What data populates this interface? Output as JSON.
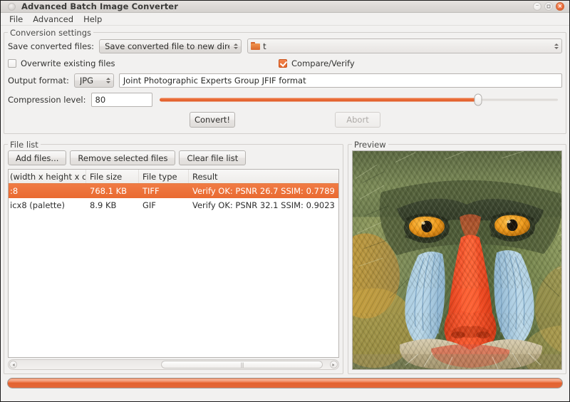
{
  "window": {
    "title": "Advanced Batch Image Converter",
    "app_icon": "app-circle-icon",
    "controls": {
      "minimize": "–",
      "maximize": "□",
      "close": "×"
    }
  },
  "menubar": {
    "items": [
      {
        "label": "File"
      },
      {
        "label": "Advanced"
      },
      {
        "label": "Help"
      }
    ]
  },
  "conversion_settings": {
    "group_title": "Conversion settings",
    "save_label": "Save converted files:",
    "save_mode": "Save converted file to new directory",
    "directory_value": "t",
    "directory_icon": "folder-icon",
    "overwrite_label": "Overwrite existing files",
    "overwrite_checked": false,
    "compare_label": "Compare/Verify",
    "compare_checked": true,
    "output_format_label": "Output format:",
    "output_format": "JPG",
    "output_format_description": "Joint Photographic Experts Group JFIF format",
    "compression_label": "Compression level:",
    "compression_value": "80",
    "compression_percent": 80,
    "convert_label": "Convert!",
    "abort_label": "Abort",
    "abort_disabled": true
  },
  "file_list": {
    "group_title": "File list",
    "buttons": [
      {
        "label": "Add files...",
        "name": "add-files-button"
      },
      {
        "label": "Remove selected files",
        "name": "remove-selected-files-button"
      },
      {
        "label": "Clear file list",
        "name": "clear-file-list-button"
      }
    ],
    "columns": [
      "(width x height x col",
      "File size",
      "File type",
      "Result"
    ],
    "rows": [
      {
        "dimensions": ":8",
        "file_size": "768.1 KB",
        "file_type": "TIFF",
        "result": "Verify OK: PSNR 26.7 SSIM: 0.7789",
        "selected": true
      },
      {
        "dimensions": "icx8 (palette)",
        "file_size": "8.9 KB",
        "file_type": "GIF",
        "result": "Verify OK: PSNR 32.1 SSIM: 0.9023",
        "selected": false
      }
    ],
    "hscroll": {
      "thumb_left_percent": 46,
      "thumb_width_percent": 52
    }
  },
  "preview": {
    "group_title": "Preview",
    "image_name": "mandrill-baboon-preview-image"
  },
  "progress": {
    "percent": 100
  },
  "colors": {
    "accent_orange": "#e96a31",
    "selection_orange": "#ee7239",
    "window_bg": "#f2f1f0",
    "preview_bg": "#cfccc9"
  }
}
